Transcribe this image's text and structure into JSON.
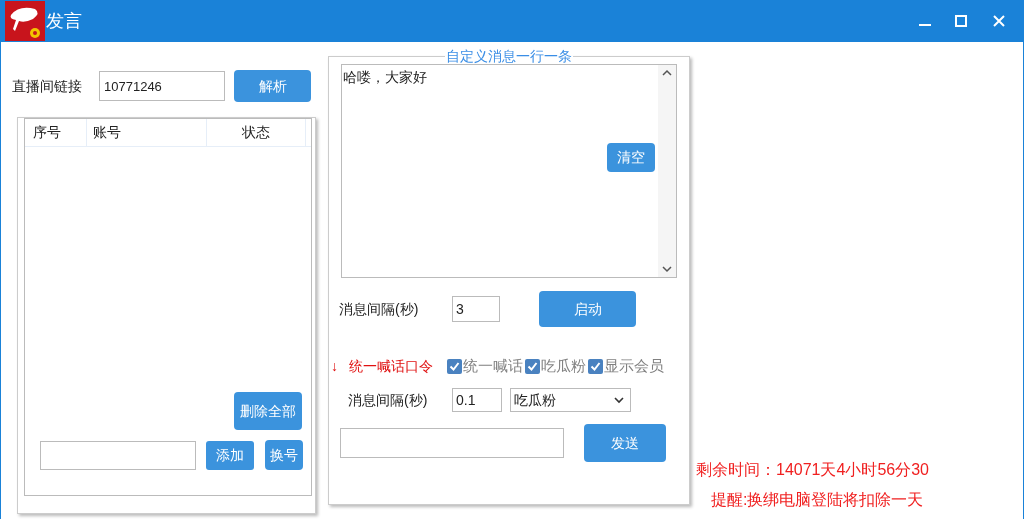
{
  "window": {
    "title": "发言"
  },
  "live_link": {
    "label": "直播间链接",
    "value": "10771246",
    "button": "解析"
  },
  "accounts": {
    "columns": [
      "序号",
      "账号",
      "状态"
    ],
    "delete_all_button": "删除全部",
    "add_button": "添加",
    "switch_button": "换号"
  },
  "custom_messages": {
    "title": "自定义消息一行一条",
    "text": "哈喽，大家好",
    "clear_button": "清空",
    "interval_label": "消息间隔(秒)",
    "interval_value": "3",
    "start_button": "启动"
  },
  "shout": {
    "arrow": "↓",
    "label": "统一喊话口令",
    "options": [
      {
        "label": "统一喊话",
        "checked": true
      },
      {
        "label": "吃瓜粉",
        "checked": true
      },
      {
        "label": "显示会员",
        "checked": true
      }
    ],
    "interval_label": "消息间隔(秒)",
    "interval_value": "0.1",
    "select_value": "吃瓜粉",
    "send_button": "发送"
  },
  "status": {
    "remaining": "剩余时间：14071天4小时56分30",
    "reminder": "提醒:换绑电脑登陆将扣除一天"
  }
}
